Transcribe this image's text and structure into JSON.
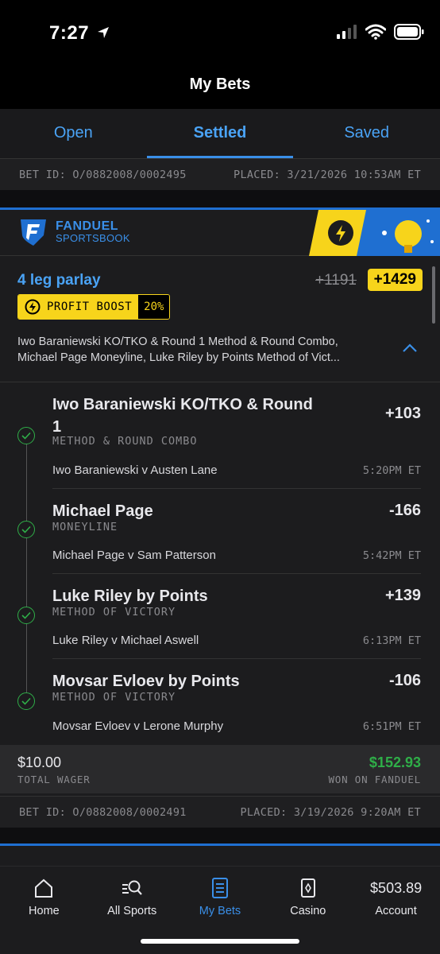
{
  "status_bar": {
    "time": "7:27"
  },
  "header": {
    "title": "My Bets"
  },
  "tabs": [
    {
      "label": "Open",
      "active": false
    },
    {
      "label": "Settled",
      "active": true
    },
    {
      "label": "Saved",
      "active": false
    }
  ],
  "prev_bet": {
    "bet_id": "BET ID: O/0882008/0002495",
    "placed": "PLACED: 3/21/2026 10:53AM ET"
  },
  "card": {
    "brand_name": "FANDUEL",
    "brand_sub": "SPORTSBOOK",
    "bet_type": "4 leg parlay",
    "odds_original": "+1191",
    "odds_boosted": "+1429",
    "boost_label": "PROFIT BOOST",
    "boost_pct": "20%",
    "summary_line1": "Iwo Baraniewski KO/TKO & Round 1 Method & Round Combo,",
    "summary_line2": "Michael Page Moneyline, Luke Riley by Points Method of Vict...",
    "legs": [
      {
        "title": "Iwo Baraniewski KO/TKO & Round 1",
        "market": "METHOD & ROUND COMBO",
        "odds": "+103",
        "event": "Iwo Baraniewski v Austen Lane",
        "time": "5:20PM ET"
      },
      {
        "title": "Michael Page",
        "market": "MONEYLINE",
        "odds": "-166",
        "event": "Michael Page v Sam Patterson",
        "time": "5:42PM ET"
      },
      {
        "title": "Luke Riley by Points",
        "market": "METHOD OF VICTORY",
        "odds": "+139",
        "event": "Luke Riley v Michael Aswell",
        "time": "6:13PM ET"
      },
      {
        "title": "Movsar Evloev by Points",
        "market": "METHOD OF VICTORY",
        "odds": "-106",
        "event": "Movsar Evloev v Lerone Murphy",
        "time": "6:51PM ET"
      }
    ],
    "wager_amount": "$10.00",
    "wager_label": "TOTAL WAGER",
    "won_amount": "$152.93",
    "won_label": "WON ON FANDUEL",
    "bet_id": "BET ID: O/0882008/0002491",
    "placed": "PLACED: 3/19/2026 9:20AM ET"
  },
  "bottom_nav": [
    {
      "label": "Home",
      "icon": "home-icon"
    },
    {
      "label": "All Sports",
      "icon": "search-sports-icon"
    },
    {
      "label": "My Bets",
      "icon": "bet-slip-icon",
      "active": true
    },
    {
      "label": "Casino",
      "icon": "cards-icon"
    },
    {
      "label": "Account",
      "value": "$503.89"
    }
  ],
  "colors": {
    "accent": "#3a8fe8",
    "boost": "#f7d41b",
    "win": "#2fae48"
  }
}
